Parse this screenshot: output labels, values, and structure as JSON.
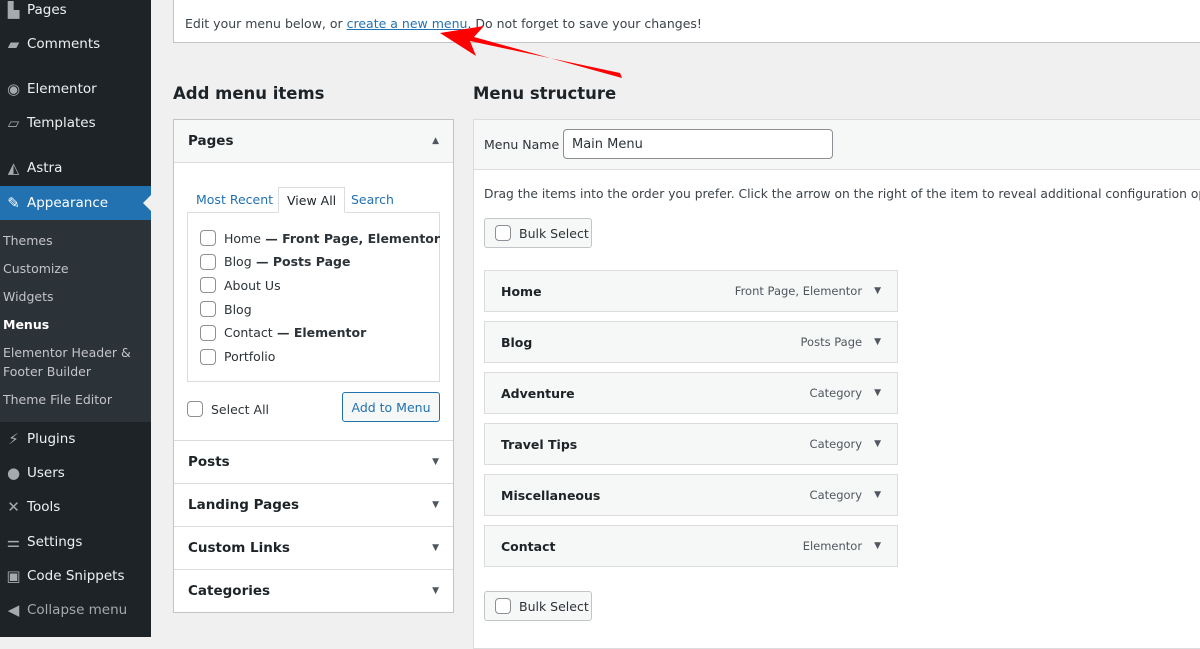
{
  "sidebar": {
    "top": [
      {
        "label": "Pages",
        "icon": "pages-icon",
        "g": "▙"
      },
      {
        "label": "Comments",
        "icon": "comments-icon",
        "g": "▰"
      },
      {
        "label": "Elementor",
        "icon": "elementor-icon",
        "g": "◉"
      },
      {
        "label": "Templates",
        "icon": "folder-icon",
        "g": "▱"
      },
      {
        "label": "Astra",
        "icon": "astra-icon",
        "g": "◭"
      },
      {
        "label": "Appearance",
        "icon": "paintbrush-icon",
        "g": "✎"
      }
    ],
    "sub": [
      "Themes",
      "Customize",
      "Widgets",
      "Menus",
      "Elementor Header &",
      "Footer Builder",
      "Theme File Editor"
    ],
    "bottom": [
      {
        "label": "Plugins",
        "icon": "plugin-icon",
        "g": "⚡"
      },
      {
        "label": "Users",
        "icon": "user-icon",
        "g": "●"
      },
      {
        "label": "Tools",
        "icon": "wrench-icon",
        "g": "✕"
      },
      {
        "label": "Settings",
        "icon": "settings-icon",
        "g": "⚌"
      },
      {
        "label": "Code Snippets",
        "icon": "code-icon",
        "g": "▣"
      },
      {
        "label": "Collapse menu",
        "icon": "collapse-icon",
        "g": "◀"
      }
    ]
  },
  "notice": {
    "before": "Edit your menu below, or ",
    "link": "create a new menu",
    "after": ". Do not forget to save your changes!"
  },
  "left": {
    "title": "Add menu items",
    "pages_label": "Pages",
    "tabs": [
      "Most Recent",
      "View All",
      "Search"
    ],
    "pages": [
      {
        "name": "Home",
        "meta": " — Front Page, Elementor"
      },
      {
        "name": "Blog",
        "meta": " — Posts Page"
      },
      {
        "name": "About Us",
        "meta": ""
      },
      {
        "name": "Blog",
        "meta": ""
      },
      {
        "name": "Contact",
        "meta": " — Elementor"
      },
      {
        "name": "Portfolio",
        "meta": ""
      }
    ],
    "select_all": "Select All",
    "add_button": "Add to Menu",
    "sections": [
      "Posts",
      "Landing Pages",
      "Custom Links",
      "Categories"
    ]
  },
  "right": {
    "title": "Menu structure",
    "menu_name_label": "Menu Name",
    "menu_name_value": "Main Menu",
    "instructions": "Drag the items into the order you prefer. Click the arrow on the right of the item to reveal additional configuration options.",
    "bulk": "Bulk Select",
    "items": [
      {
        "title": "Home",
        "type": "Front Page, Elementor"
      },
      {
        "title": "Blog",
        "type": "Posts Page"
      },
      {
        "title": "Adventure",
        "type": "Category"
      },
      {
        "title": "Travel Tips",
        "type": "Category"
      },
      {
        "title": "Miscellaneous",
        "type": "Category"
      },
      {
        "title": "Contact",
        "type": "Elementor"
      }
    ]
  },
  "annotation_color": "#ff0000"
}
